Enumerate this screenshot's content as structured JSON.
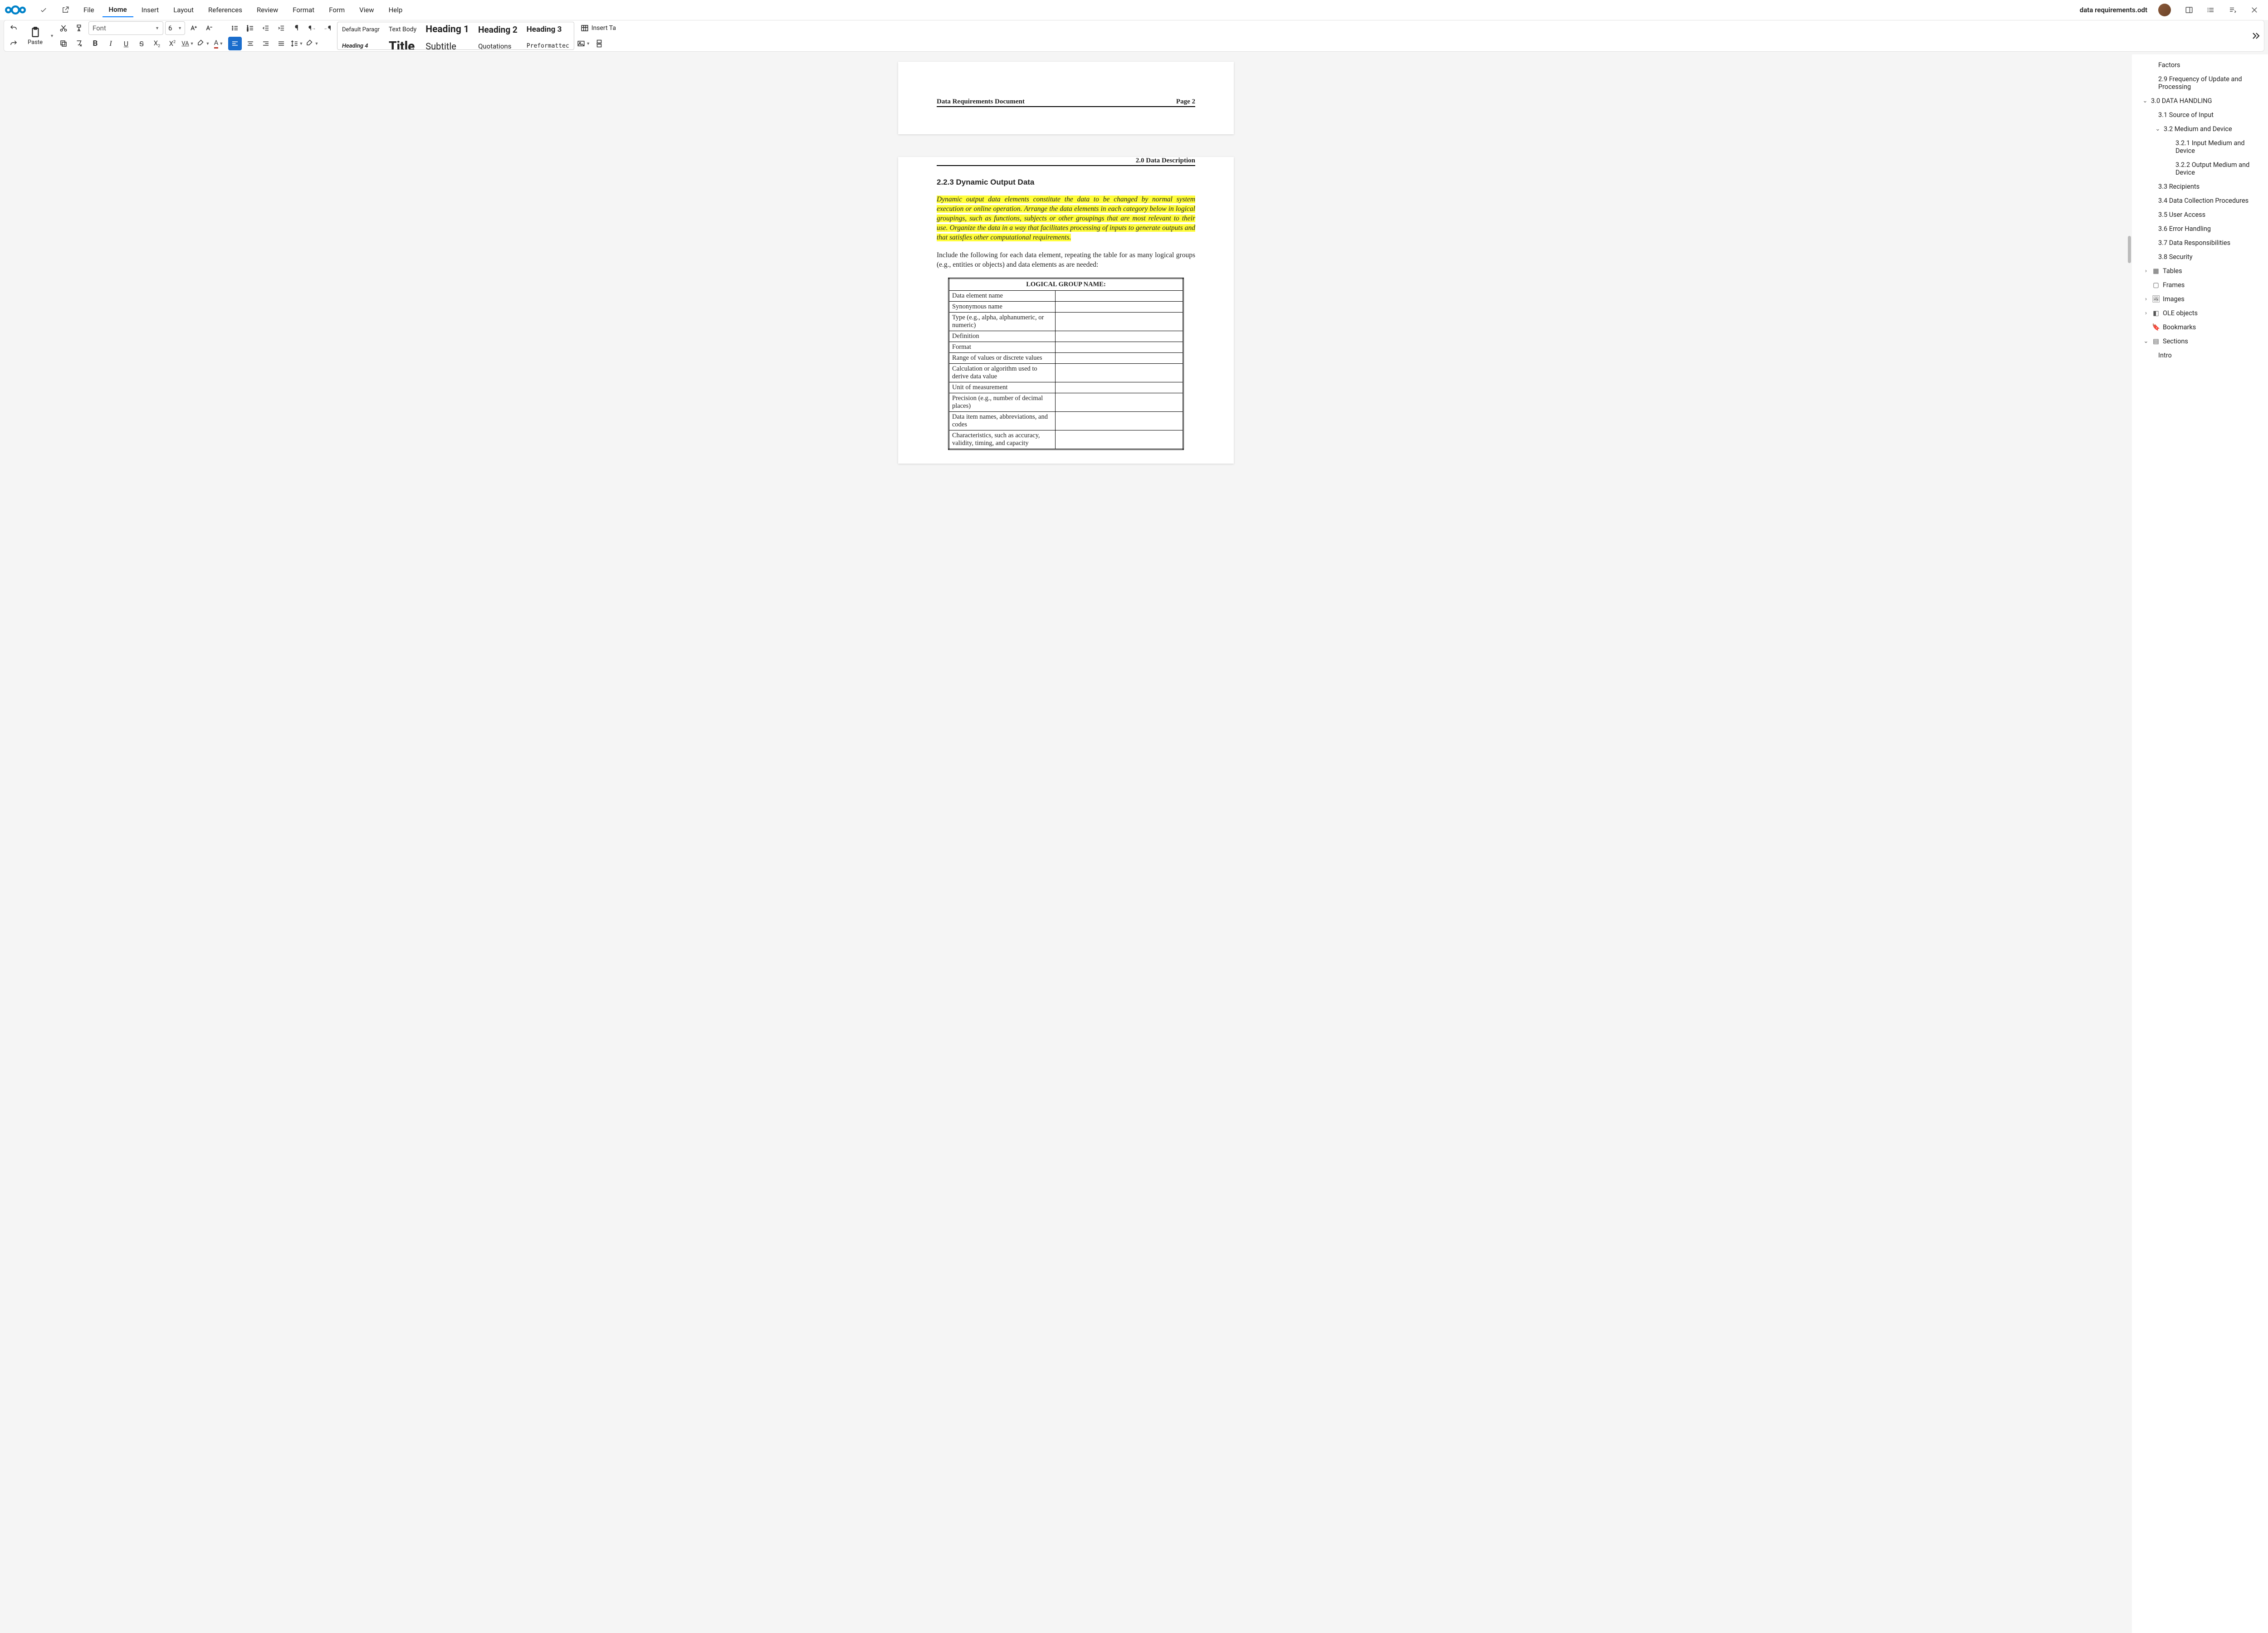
{
  "title": "data requirements.odt",
  "menu": {
    "file": "File",
    "home": "Home",
    "insert": "Insert",
    "layout": "Layout",
    "references": "References",
    "review": "Review",
    "format": "Format",
    "form": "Form",
    "view": "View",
    "help": "Help"
  },
  "ribbon": {
    "paste": "Paste",
    "font_name": "Font",
    "font_size": "6",
    "insert_table": "Insert Ta",
    "styles": {
      "default": "Default Paragr",
      "textbody": "Text Body",
      "h1": "Heading 1",
      "h2": "Heading 2",
      "h3": "Heading 3",
      "h4": "Heading 4",
      "title": "Title",
      "subtitle": "Subtitle",
      "quotations": "Quotations",
      "preformatted": "Preformattec"
    }
  },
  "doc": {
    "header_left": "Data Requirements Document",
    "header_right": "Page 2",
    "section_head": "2.0  Data Description",
    "h": "2.2.3   Dynamic Output Data",
    "p1": "Dynamic output data elements constitute the data to be changed by normal system execution or online operation.  Arrange the data elements in each category below in logical groupings, such as functions, subjects or other groupings that are most relevant to their use.  Organize the data in a way that facilitates processing of inputs to generate outputs and that satisfies other computational requirements.",
    "p2": "Include the following for each data element, repeating the table for as many logical groups (e.g., entities or objects) and data elements as are needed:",
    "table_caption": "LOGICAL GROUP NAME:",
    "rows": [
      "Data element name",
      "Synonymous name",
      "Type (e.g., alpha, alphanumeric, or numeric)",
      "Definition",
      "Format",
      "Range of values or discrete values",
      "Calculation or algorithm used to derive data value",
      "Unit of measurement",
      "Precision (e.g., number of decimal places)",
      "Data item names, abbreviations, and codes",
      "Characteristics, such as accuracy, validity, timing, and capacity"
    ]
  },
  "nav": {
    "factors": "Factors",
    "s29": "2.9 Frequency of Update and Processing",
    "s30": "3.0 DATA HANDLING",
    "s31": "3.1 Source of Input",
    "s32": "3.2 Medium and Device",
    "s321": "3.2.1 Input Medium and Device",
    "s322": "3.2.2 Output Medium and Device",
    "s33": "3.3 Recipients",
    "s34": "3.4 Data Collection Procedures",
    "s35": "3.5 User Access",
    "s36": "3.6 Error Handling",
    "s37": "3.7 Data Responsibilities",
    "s38": "3.8 Security",
    "tables": "Tables",
    "frames": "Frames",
    "images": "Images",
    "ole": "OLE objects",
    "bookmarks": "Bookmarks",
    "sections": "Sections",
    "intro": "Intro"
  }
}
